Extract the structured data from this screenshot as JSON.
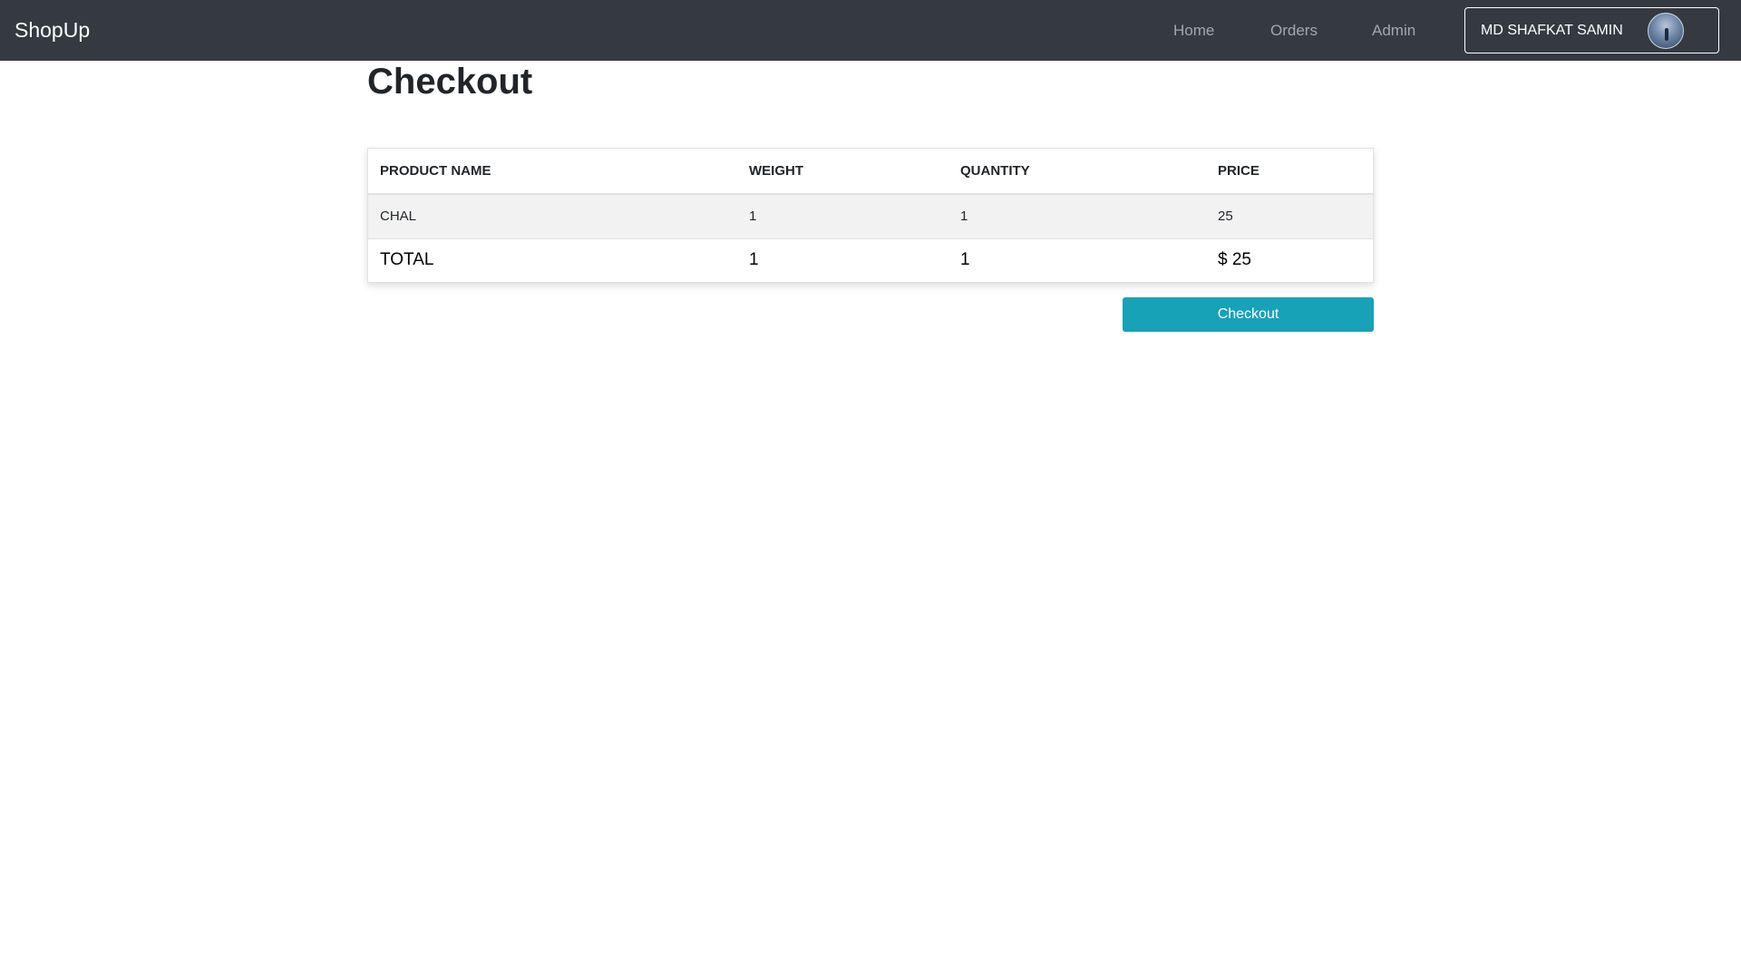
{
  "navbar": {
    "brand": "ShopUp",
    "links": [
      "Home",
      "Orders",
      "Admin"
    ],
    "user_name": "MD SHAFKAT SAMIN"
  },
  "page": {
    "title": "Checkout"
  },
  "table": {
    "headers": [
      "PRODUCT NAME",
      "WEIGHT",
      "QUANTITY",
      "PRICE"
    ],
    "rows": [
      {
        "name": "CHAL",
        "weight": "1",
        "quantity": "1",
        "price": "25"
      }
    ],
    "total": {
      "label": "TOTAL",
      "weight": "1",
      "quantity": "1",
      "price": "$ 25"
    }
  },
  "actions": {
    "checkout_label": "Checkout"
  },
  "colors": {
    "navbar_bg": "#343a40",
    "accent": "#17a2b8",
    "row_bg": "#f2f2f2"
  }
}
